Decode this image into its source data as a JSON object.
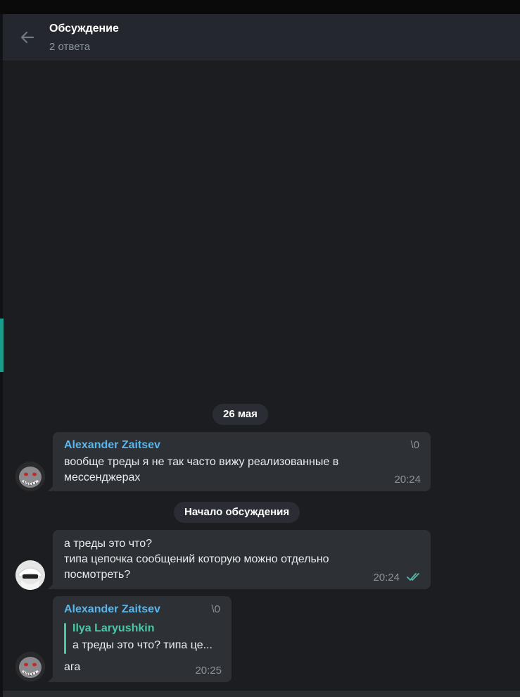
{
  "header": {
    "title": "Обсуждение",
    "subtitle": "2 ответа"
  },
  "date_separator": "26 мая",
  "thread_start_label": "Начало обсуждения",
  "messages": [
    {
      "sender": "Alexander Zaitsev",
      "tag": "\\0",
      "lines": [
        "вообще треды я не так часто вижу реализованные в",
        "мессенджерах"
      ],
      "time": "20:24"
    },
    {
      "lines": [
        "а треды это что?",
        "типа цепочка сообщений которую можно отдельно",
        "посмотреть?"
      ],
      "time": "20:24",
      "status": "read-double-check-icon"
    },
    {
      "sender": "Alexander Zaitsev",
      "tag": "\\0",
      "reply": {
        "name": "Ilya Laryushkin",
        "text": "а треды это что? типа це..."
      },
      "lines": [
        "ага"
      ],
      "time": "20:25"
    }
  ],
  "colors": {
    "sender": "#5ab6ec",
    "reply_accent": "#48c8a8",
    "check": "#4fb9a8",
    "bubble": "#2d3035"
  }
}
